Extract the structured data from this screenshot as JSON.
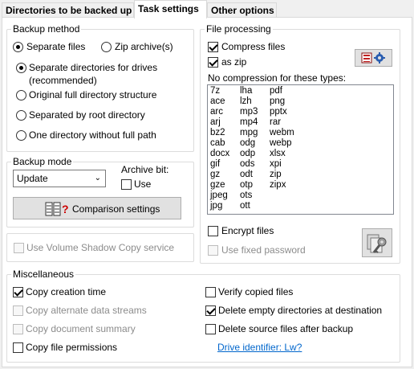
{
  "tabs": [
    {
      "label": "Directories to be backed up"
    },
    {
      "label": "Task settings"
    },
    {
      "label": "Other options"
    }
  ],
  "backup_method": {
    "title": "Backup method",
    "separate_files": "Separate files",
    "zip_archives": "Zip archive(s)",
    "sep_dirs_line1": "Separate directories for drives",
    "sep_dirs_line2": "(recommended)",
    "original_structure": "Original full directory structure",
    "separated_root": "Separated by root directory",
    "one_directory": "One directory without full path"
  },
  "backup_mode": {
    "title": "Backup mode",
    "value": "Update",
    "archive_bit": "Archive bit:",
    "use": "Use",
    "comparison_button": "Comparison settings"
  },
  "vss": {
    "label": "Use Volume Shadow Copy service"
  },
  "file_processing": {
    "title": "File processing",
    "compress": "Compress files",
    "as_zip": "as zip",
    "no_compression": "No compression for these types:",
    "types_col1": [
      "7z",
      "ace",
      "arc",
      "arj",
      "bz2",
      "cab",
      "docx",
      "gif",
      "gz",
      "gze",
      "jpeg",
      "jpg"
    ],
    "types_col2": [
      "lha",
      "lzh",
      "mp3",
      "mp4",
      "mpg",
      "odg",
      "odp",
      "ods",
      "odt",
      "otp",
      "ots",
      "ott"
    ],
    "types_col3": [
      "pdf",
      "png",
      "pptx",
      "rar",
      "webm",
      "webp",
      "xlsx",
      "xpi",
      "zip",
      "zipx"
    ],
    "encrypt": "Encrypt files",
    "fixed_password": "Use fixed password"
  },
  "misc": {
    "title": "Miscellaneous",
    "copy_creation": "Copy creation time",
    "copy_alt_streams": "Copy alternate data streams",
    "copy_doc_summary": "Copy document summary",
    "copy_permissions": "Copy file permissions",
    "verify": "Verify copied files",
    "delete_empty": "Delete empty directories at destination",
    "delete_source": "Delete source files after backup",
    "drive_identifier": "Drive identifier: Lw?"
  }
}
